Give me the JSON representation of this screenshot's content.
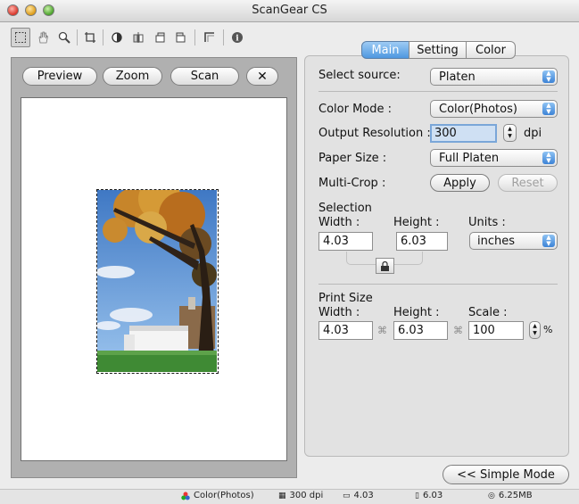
{
  "window": {
    "title": "ScanGear CS"
  },
  "toolbar": {
    "tools": [
      {
        "icon": "marquee-select-icon"
      },
      {
        "icon": "hand-icon"
      },
      {
        "icon": "zoom-icon"
      },
      {
        "icon": "crop-icon"
      },
      {
        "icon": "invert-icon"
      },
      {
        "icon": "mirror-icon"
      },
      {
        "icon": "rotate-left-icon"
      },
      {
        "icon": "rotate-right-icon"
      },
      {
        "icon": "auto-crop-icon"
      },
      {
        "icon": "info-icon"
      }
    ]
  },
  "preview": {
    "preview_label": "Preview",
    "zoom_label": "Zoom",
    "scan_label": "Scan",
    "close_symbol": "✕"
  },
  "tabs": [
    {
      "label": "Main",
      "active": true
    },
    {
      "label": "Setting",
      "active": false
    },
    {
      "label": "Color",
      "active": false
    }
  ],
  "main": {
    "select_source_label": "Select source:",
    "select_source_value": "Platen",
    "color_mode_label": "Color Mode :",
    "color_mode_value": "Color(Photos)",
    "output_resolution_label": "Output Resolution :",
    "output_resolution_value": "300",
    "dpi_unit": "dpi",
    "paper_size_label": "Paper Size :",
    "paper_size_value": "Full Platen",
    "multi_crop_label": "Multi-Crop :",
    "apply_label": "Apply",
    "reset_label": "Reset",
    "selection": {
      "heading": "Selection",
      "width_label": "Width :",
      "height_label": "Height :",
      "units_label": "Units :",
      "width_value": "4.03",
      "height_value": "6.03",
      "units_value": "inches"
    },
    "print_size": {
      "heading": "Print Size",
      "width_label": "Width :",
      "height_label": "Height :",
      "scale_label": "Scale :",
      "width_value": "4.03",
      "height_value": "6.03",
      "scale_value": "100",
      "percent": "%"
    },
    "simple_mode_label": "<< Simple Mode"
  },
  "status_bar": {
    "color_mode": "Color(Photos)",
    "resolution": "300 dpi",
    "width": "4.03",
    "height": "6.03",
    "file_size": "6.25MB"
  }
}
